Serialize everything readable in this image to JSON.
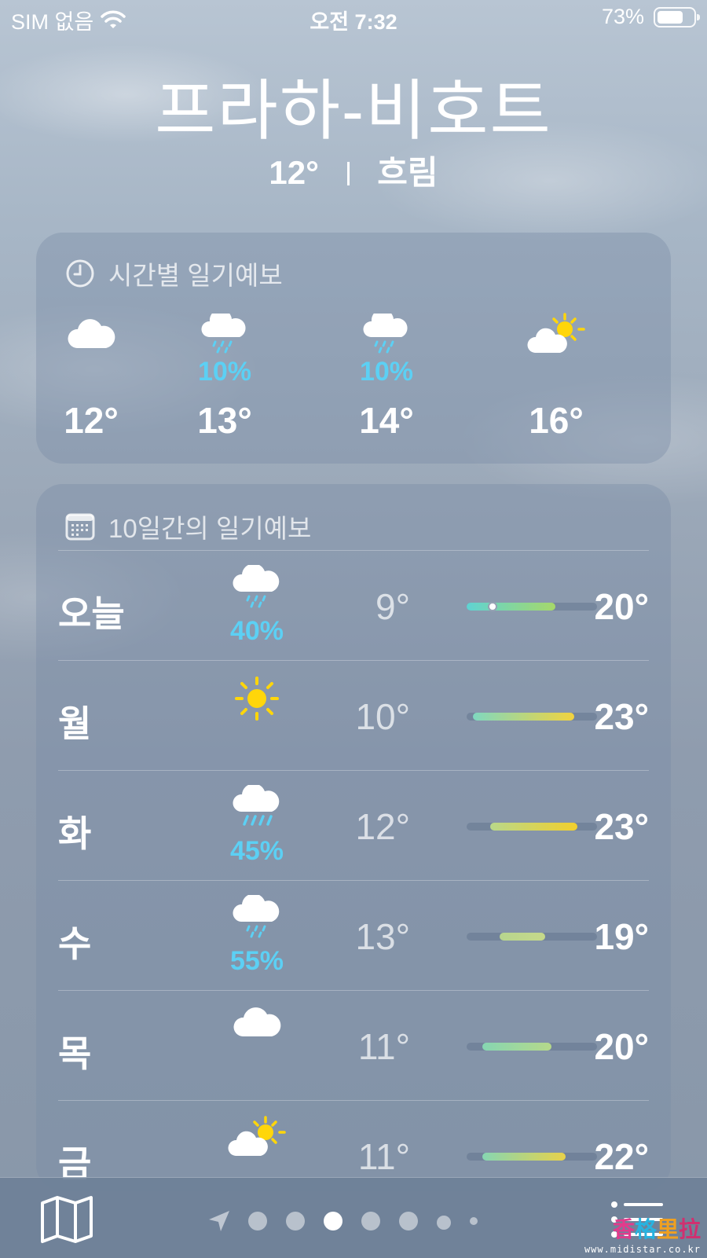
{
  "status_bar": {
    "carrier": "SIM 없음",
    "time": "오전 7:32",
    "battery": "73%",
    "battery_level": 0.73
  },
  "header": {
    "city": "프라하-비호트",
    "temp": "12°",
    "condition": "흐림"
  },
  "hourly": {
    "title": "시간별 일기예보",
    "items": [
      {
        "icon": "cloud-icon",
        "pct": "",
        "temp": "12°"
      },
      {
        "icon": "cloud-drizzle-icon",
        "pct": "10%",
        "temp": "13°"
      },
      {
        "icon": "cloud-drizzle-icon",
        "pct": "10%",
        "temp": "14°"
      },
      {
        "icon": "partly-sunny-icon",
        "pct": "",
        "temp": "16°"
      }
    ]
  },
  "daily": {
    "title": "10일간의 일기예보",
    "rows": [
      {
        "day": "오늘",
        "icon": "cloud-rain-icon",
        "pct": "40%",
        "low": "9°",
        "high": "20°",
        "bar": {
          "start": 0.0,
          "end": 0.68,
          "dot": 0.2,
          "colors": [
            "#5fd3d3",
            "#a6d86a"
          ]
        }
      },
      {
        "day": "월",
        "icon": "sun-icon",
        "pct": "",
        "low": "10°",
        "high": "23°",
        "bar": {
          "start": 0.05,
          "end": 0.83,
          "colors": [
            "#7fd8c0",
            "#f2d33e"
          ]
        }
      },
      {
        "day": "화",
        "icon": "cloud-rain-heavy-icon",
        "pct": "45%",
        "low": "12°",
        "high": "23°",
        "bar": {
          "start": 0.18,
          "end": 0.85,
          "colors": [
            "#b9d88a",
            "#f2cf2c"
          ]
        }
      },
      {
        "day": "수",
        "icon": "cloud-rain-icon",
        "pct": "55%",
        "low": "13°",
        "high": "19°",
        "bar": {
          "start": 0.25,
          "end": 0.6,
          "colors": [
            "#b7d58e",
            "#c6d98a"
          ]
        }
      },
      {
        "day": "목",
        "icon": "cloud-icon",
        "pct": "",
        "low": "11°",
        "high": "20°",
        "bar": {
          "start": 0.12,
          "end": 0.65,
          "colors": [
            "#86d6b2",
            "#b6d98a"
          ]
        }
      },
      {
        "day": "금",
        "icon": "partly-sunny-icon",
        "pct": "",
        "low": "11°",
        "high": "22°",
        "bar": {
          "start": 0.12,
          "end": 0.76,
          "colors": [
            "#86d6b2",
            "#e8d24a"
          ]
        }
      }
    ]
  },
  "bottom_bar": {
    "map_icon": "map-icon",
    "location_icon": "location-arrow-icon",
    "list_icon": "list-icon",
    "page_count": 7,
    "active_page": 2
  },
  "watermark": {
    "logo": "香格里拉",
    "url": "www.midistar.co.kr"
  }
}
